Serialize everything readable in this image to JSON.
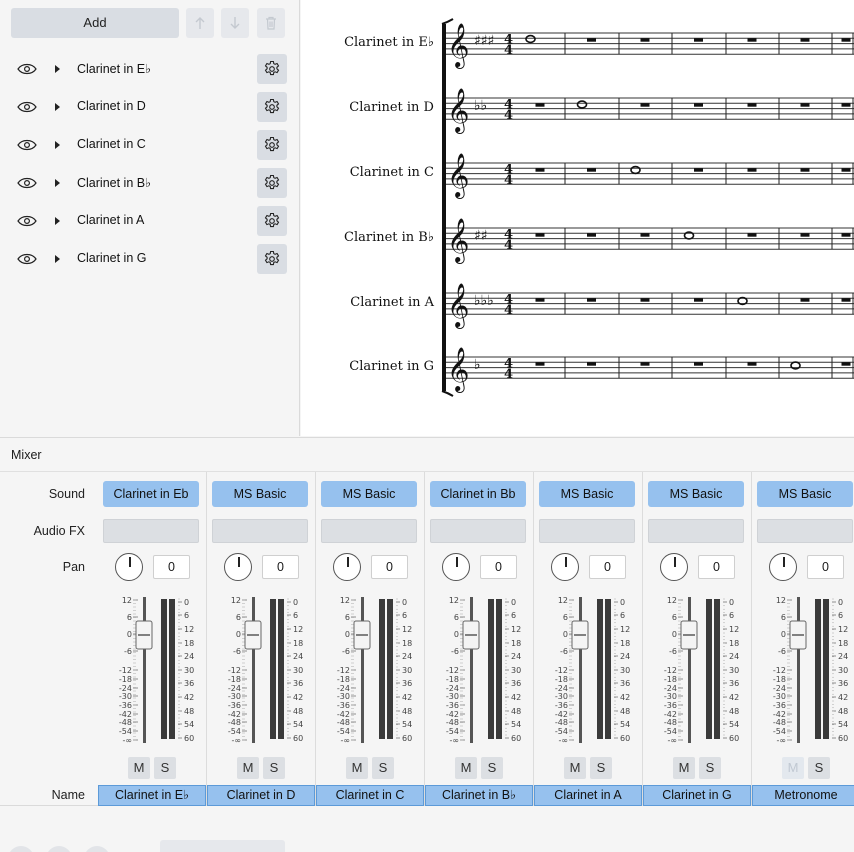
{
  "instruments_panel": {
    "add_label": "Add",
    "items": [
      {
        "label": "Clarinet in E♭"
      },
      {
        "label": "Clarinet in D"
      },
      {
        "label": "Clarinet in C"
      },
      {
        "label": "Clarinet in B♭"
      },
      {
        "label": "Clarinet in A"
      },
      {
        "label": "Clarinet in G"
      }
    ]
  },
  "score": {
    "staves": [
      {
        "label": "Clarinet in E♭",
        "key": "3 sharps",
        "note_measure": 1
      },
      {
        "label": "Clarinet in D",
        "key": "2 flats",
        "note_measure": 2
      },
      {
        "label": "Clarinet in C",
        "key": "none",
        "note_measure": 3
      },
      {
        "label": "Clarinet in B♭",
        "key": "2 sharps",
        "note_measure": 4
      },
      {
        "label": "Clarinet in A",
        "key": "3 flats",
        "note_measure": 5
      },
      {
        "label": "Clarinet in G",
        "key": "1 flat",
        "note_measure": 6
      }
    ],
    "time_signature": "4/4"
  },
  "mixer": {
    "title": "Mixer",
    "row_labels": {
      "sound": "Sound",
      "audio_fx": "Audio FX",
      "pan": "Pan",
      "name": "Name"
    },
    "scale_left": [
      "12",
      "6",
      "0",
      "-6",
      "-12",
      "-18",
      "-24",
      "-30",
      "-36",
      "-42",
      "-48",
      "-54",
      "-∞"
    ],
    "scale_right": [
      "0",
      "6",
      "12",
      "18",
      "24",
      "30",
      "36",
      "42",
      "48",
      "54",
      "60"
    ],
    "mute_label": "M",
    "solo_label": "S",
    "channels": [
      {
        "sound": "Clarinet in Eb",
        "pan": "0",
        "name": "Clarinet in E♭",
        "mute_disabled": false
      },
      {
        "sound": "MS Basic",
        "pan": "0",
        "name": "Clarinet in D",
        "mute_disabled": false
      },
      {
        "sound": "MS Basic",
        "pan": "0",
        "name": "Clarinet in C",
        "mute_disabled": false
      },
      {
        "sound": "Clarinet in Bb",
        "pan": "0",
        "name": "Clarinet in B♭",
        "mute_disabled": false
      },
      {
        "sound": "MS Basic",
        "pan": "0",
        "name": "Clarinet in A",
        "mute_disabled": false
      },
      {
        "sound": "MS Basic",
        "pan": "0",
        "name": "Clarinet in G",
        "mute_disabled": false
      },
      {
        "sound": "MS Basic",
        "pan": "0",
        "name": "Metronome",
        "mute_disabled": true
      }
    ]
  },
  "colors": {
    "accent": "#96c1ee",
    "accent_border": "#5c9ad8",
    "button_bg": "#d9dde3",
    "panel_bg": "#f5f5f5"
  }
}
